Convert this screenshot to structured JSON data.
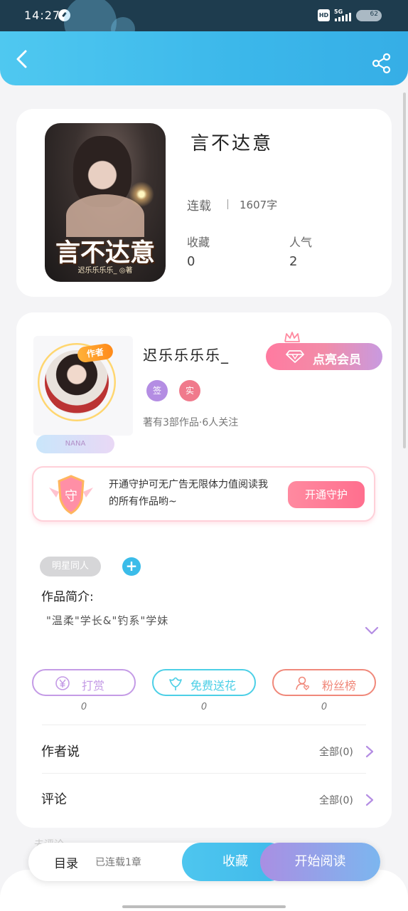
{
  "status_bar": {
    "time": "14:27",
    "hd": "HD",
    "network": "5G",
    "battery": "62"
  },
  "header": {
    "back_icon": "back-arrow-icon",
    "share_icon": "share-icon"
  },
  "book": {
    "cover_title": "言不达意",
    "cover_author": "迟乐乐乐乐_ ◎著",
    "title": "言不达意",
    "status": "连载",
    "words": "1607字",
    "stats": [
      {
        "label": "收藏",
        "value": "0"
      },
      {
        "label": "人气",
        "value": "2"
      }
    ]
  },
  "author": {
    "badge": "作者",
    "nana": "NANA",
    "name": "迟乐乐乐乐_",
    "vip_label": "点亮会员",
    "tags": [
      {
        "label": "签",
        "color": "#b48de3"
      },
      {
        "label": "实",
        "color": "#f07a8c"
      }
    ],
    "works": "著有3部作品·6人关注"
  },
  "guard": {
    "text": "开通守护可无广告无限体力值阅读我的所有作品哟~",
    "button": "开通守护",
    "shield_char": "守"
  },
  "intro": {
    "tag": "明星同人",
    "add": "+",
    "label": "作品简介:",
    "text": "\"温柔\"学长&\"钓系\"学妹"
  },
  "actions": [
    {
      "label": "打赏",
      "count": "0",
      "color": "#c49be6",
      "icon": "yen-coin-icon"
    },
    {
      "label": "免费送花",
      "count": "0",
      "color": "#4ccfe6",
      "icon": "flower-icon"
    },
    {
      "label": "粉丝榜",
      "count": "0",
      "color": "#f0887a",
      "icon": "fan-user-icon"
    }
  ],
  "rows": [
    {
      "label": "作者说",
      "link": "全部(0)"
    },
    {
      "label": "评论",
      "link": "全部(0)"
    }
  ],
  "bottom": {
    "faded": "去评论",
    "toc": "目录",
    "toc_status": "已连载1章",
    "collect": "收藏",
    "read": "开始阅读"
  }
}
